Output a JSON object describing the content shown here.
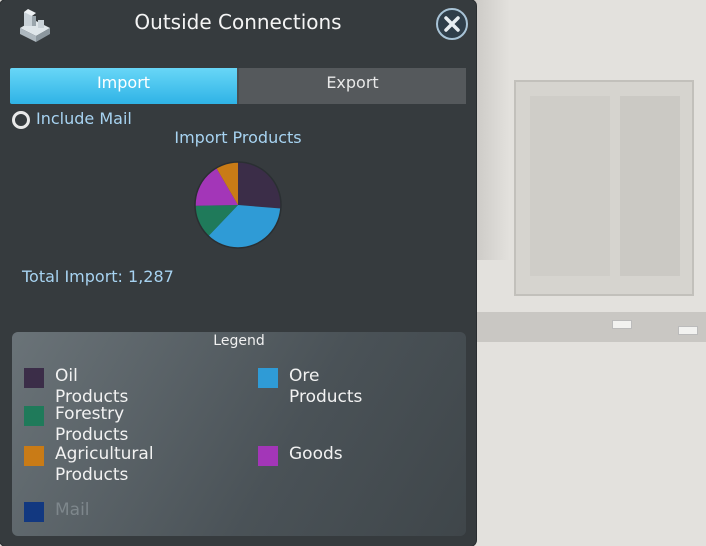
{
  "window": {
    "title": "Outside Connections",
    "close_icon": "close-icon",
    "app_icon": "city-building-icon"
  },
  "tabs": [
    {
      "label": "Import",
      "active": true
    },
    {
      "label": "Export",
      "active": false
    }
  ],
  "mail_toggle": {
    "label": "Include Mail",
    "checked": false
  },
  "chart_title": "Import Products",
  "total_text": "Total Import: 1,287",
  "chart_data": {
    "type": "pie",
    "title": "Import Products",
    "slices": [
      {
        "label": "Oil Products",
        "value": 25,
        "color": "#3b2d48"
      },
      {
        "label": "Ore Products",
        "value": 34,
        "color": "#2f9bd6"
      },
      {
        "label": "Forestry Products",
        "value": 12,
        "color": "#1f7a5a"
      },
      {
        "label": "Goods",
        "value": 16,
        "color": "#a336b8"
      },
      {
        "label": "Agricultural Products",
        "value": 8,
        "color": "#c97b16"
      },
      {
        "label": "Mail",
        "value": 0,
        "color": "#123880"
      }
    ]
  },
  "legend": {
    "title": "Legend",
    "items": [
      {
        "label": "Oil Products",
        "color": "#3b2d48",
        "dim": false
      },
      {
        "label": "Ore Products",
        "color": "#2f9bd6",
        "dim": false
      },
      {
        "label": "Forestry Products",
        "color": "#1f7a5a",
        "dim": false
      },
      {
        "label": "Agricultural\nProducts",
        "color": "#c97b16",
        "dim": false
      },
      {
        "label": "Goods",
        "color": "#a336b8",
        "dim": false
      },
      {
        "label": "Mail",
        "color": "#123880",
        "dim": true
      }
    ]
  },
  "colors": {
    "accent": "#3ab7e8",
    "panel": "#363b3e",
    "label_blue": "#a7d3f1"
  }
}
